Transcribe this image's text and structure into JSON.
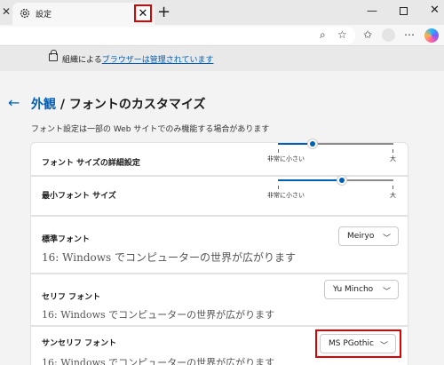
{
  "browser": {
    "tab_title": "設定",
    "tab_close_glyph": "✕",
    "new_tab_glyph": "+",
    "left_close_glyph": "✕",
    "window_min_glyph": "—",
    "window_close_glyph": "✕",
    "highlight_color": "#e00000",
    "accent_color": "#005fb8"
  },
  "toolbar": {
    "zoom_glyph": "⌕",
    "favorite_glyph": "☆",
    "favorites_glyph": "✩",
    "more_glyph": "⋯",
    "icons": [
      "zoom-icon",
      "favorite-star-icon",
      "favorites-bar-icon",
      "profile-avatar",
      "more-icon",
      "copilot-icon"
    ]
  },
  "managed": {
    "prefix": "組織による",
    "link": "ブラウザーは管理されています"
  },
  "page": {
    "back_glyph": "←",
    "breadcrumb_parent": "外観",
    "breadcrumb_sep": " / ",
    "breadcrumb_current": "フォントのカスタマイズ",
    "note": "フォント設定は一部の Web サイトでのみ機能する場合があります"
  },
  "settings": {
    "font_size": {
      "label": "フォント サイズの詳細設定",
      "min_label": "非常に小さい",
      "max_label": "大",
      "level": 0.3
    },
    "min_font_size": {
      "label": "最小フォント サイズ",
      "min_label": "非常に小さい",
      "max_label": "大",
      "level": 0.55
    },
    "standard_font": {
      "label": "標準フォント",
      "value": "Meiryo",
      "sample": "16: Windows でコンピューターの世界が広がります"
    },
    "serif_font": {
      "label": "セリフ フォント",
      "value": "Yu Mincho",
      "sample": "16: Windows でコンピューターの世界が広がります"
    },
    "sans_serif_font": {
      "label": "サンセリフ フォント",
      "value": "MS PGothic",
      "sample": "16: Windows でコンピューターの世界が広がります"
    }
  }
}
